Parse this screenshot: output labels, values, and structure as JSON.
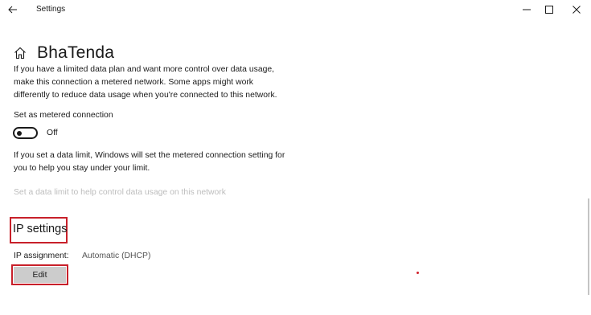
{
  "window": {
    "title": "Settings",
    "controls": {
      "minimize": "minimize-icon",
      "maximize": "maximize-icon",
      "close": "close-icon"
    }
  },
  "header": {
    "icon": "home-icon",
    "title": "BhaTenda"
  },
  "metered": {
    "description": "If you have a limited data plan and want more control over data usage, make this connection a metered network. Some apps might work differently to reduce data usage when you're connected to this network.",
    "label": "Set as metered connection",
    "toggle_state": "Off",
    "toggle_on": false,
    "note": "If you set a data limit, Windows will set the metered connection setting for you to help you stay under your limit.",
    "data_limit_link": "Set a data limit to help control data usage on this network"
  },
  "ip_settings": {
    "heading": "IP settings",
    "assignment_label": "IP assignment:",
    "assignment_value": "Automatic (DHCP)",
    "edit_label": "Edit"
  },
  "colors": {
    "highlight": "#c8202a",
    "disabled_link": "#bdbdbd",
    "button_bg": "#cccccc"
  }
}
